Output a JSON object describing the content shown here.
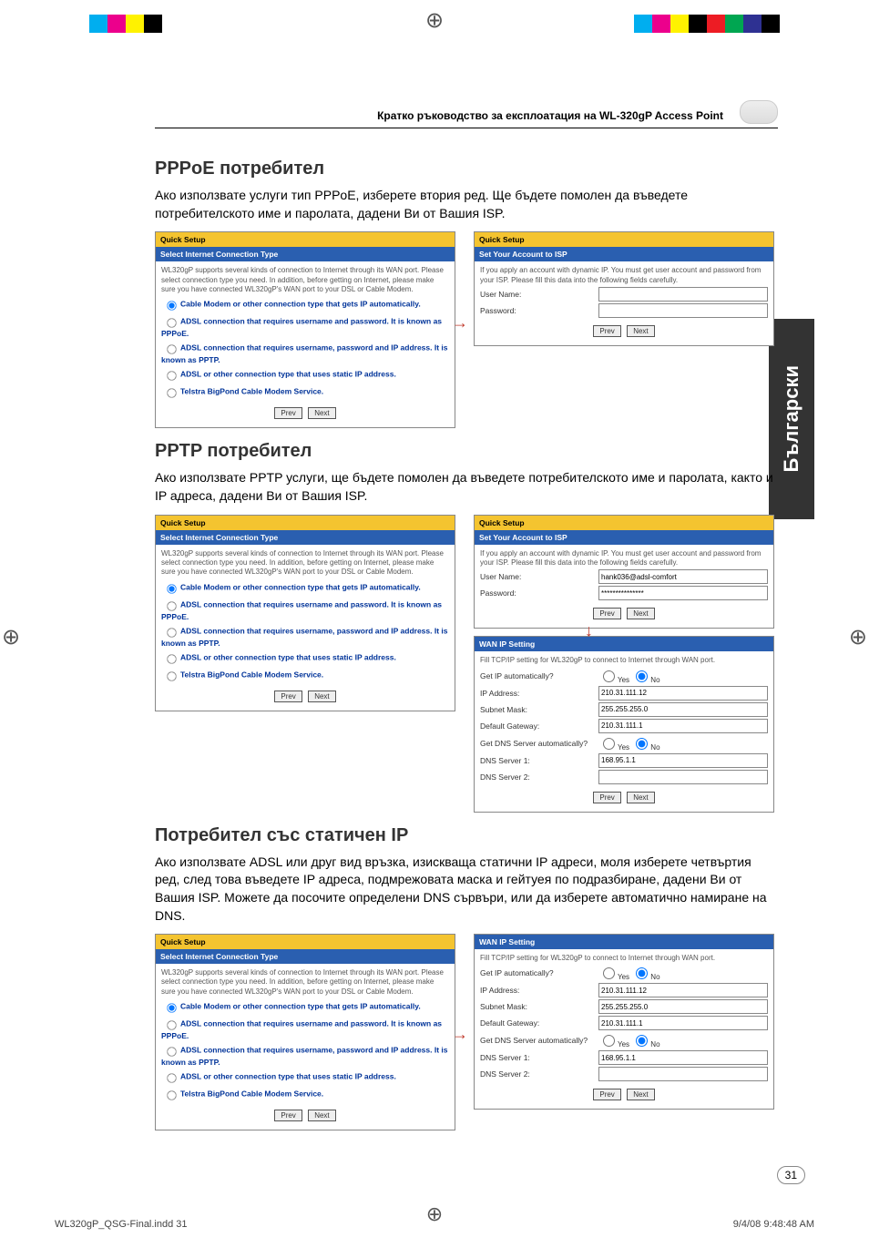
{
  "header": {
    "title": "Кратко ръководство за експлоатация на WL-320gP Access Point"
  },
  "side_tab": "Български",
  "sections": {
    "pppoe": {
      "heading": "PPPoE потребител",
      "intro": "Ако използвате услуги тип PPPoE, изберете втория ред. Ще бъдете помолен да въведете потребителското име и паролата, дадени Ви от Вашия ISP."
    },
    "pptp": {
      "heading": "PPTP потребител",
      "intro": "Ако използвате PPTP услуги, ще бъдете помолен да въведете потребителското име и паролата, както и IP адреса, дадени Ви от Вашия ISP."
    },
    "static": {
      "heading": "Потребител със статичен IP",
      "intro": "Ако използвате ADSL или друг вид връзка, изискваща статични IP адреси, моля изберете четвъртия ред, след това въведете IP адреса, подмрежовата маска и гейтуея по подразбиране, дадени Ви от Вашия ISP. Можете да посочите определени DNS сървъри, или да изберете автоматично намиране на DNS."
    }
  },
  "panel": {
    "quick_setup": "Quick Setup",
    "select_conn": "Select Internet Connection Type",
    "desc": "WL320gP supports several kinds of connection to Internet through its WAN port. Please select connection type you need. In addition, before getting on Internet, please make sure you have connected WL320gP's WAN port to your DSL or Cable Modem.",
    "opt1": "Cable Modem or other connection type that gets IP automatically.",
    "opt2": "ADSL connection that requires username and password. It is known as PPPoE.",
    "opt3": "ADSL connection that requires username, password and IP address. It is known as PPTP.",
    "opt4": "ADSL or other connection type that uses static IP address.",
    "opt5": "Telstra BigPond Cable Modem Service.",
    "prev": "Prev",
    "next": "Next",
    "set_account": "Set Your Account to ISP",
    "acct_desc": "If you apply an account with dynamic IP. You must get user account and password from your ISP. Please fill this data into the following fields carefully.",
    "user_label": "User Name:",
    "pass_label": "Password:",
    "wan_ip": "WAN IP Setting",
    "wan_desc": "Fill TCP/IP setting for WL320gP to connect to Internet through WAN port.",
    "get_ip": "Get IP automatically?",
    "ip_addr": "IP Address:",
    "subnet": "Subnet Mask:",
    "gateway": "Default Gateway:",
    "get_dns": "Get DNS Server automatically?",
    "dns1": "DNS Server 1:",
    "dns2": "DNS Server 2:",
    "yes": "Yes",
    "no": "No"
  },
  "values": {
    "user": "hank036@adsl-comfort",
    "pass": "***************",
    "ip": "210.31.111.12",
    "mask": "255.255.255.0",
    "gw": "210.31.111.1",
    "dns1": "168.95.1.1",
    "dns2": ""
  },
  "footer": {
    "file": "WL320gP_QSG-Final.indd   31",
    "date": "9/4/08   9:48:48 AM",
    "page": "31"
  },
  "colors": [
    "#00aeef",
    "#ec008c",
    "#fff200",
    "#000000",
    "#ed1c24",
    "#00a651",
    "#2e3192",
    "#f7941d"
  ]
}
